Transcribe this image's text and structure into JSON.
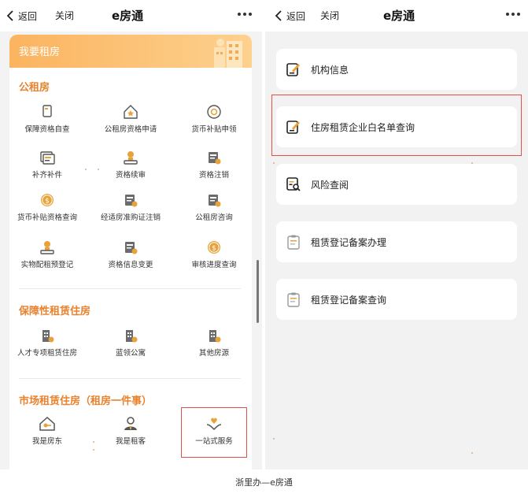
{
  "caption": "浙里办—e房通",
  "colors": {
    "accent": "#e8822d",
    "banner_start": "#fbb460",
    "banner_end": "#fdd18e",
    "highlight": "#e0514c"
  },
  "left": {
    "nav": {
      "back": "返回",
      "close": "关闭",
      "title": "e房通"
    },
    "banner_title": "我要租房",
    "sections": [
      {
        "title": "公租房",
        "items": [
          {
            "label": "保障资格自查",
            "icon": "checklist-icon"
          },
          {
            "label": "公租房资格申请",
            "icon": "house-star-icon"
          },
          {
            "label": "货币补贴申领",
            "icon": "coin-circle-icon"
          },
          {
            "label": "补齐补件",
            "icon": "document-stack-icon"
          },
          {
            "label": "资格续审",
            "icon": "stamp-icon"
          },
          {
            "label": "资格注销",
            "icon": "certificate-icon"
          },
          {
            "label": "货币补贴资格查询",
            "icon": "dollar-coin-icon"
          },
          {
            "label": "经适房准购证注销",
            "icon": "certificate-icon"
          },
          {
            "label": "公租房咨询",
            "icon": "certificate-icon"
          },
          {
            "label": "实物配租预登记",
            "icon": "stamp-icon"
          },
          {
            "label": "资格信息变更",
            "icon": "certificate-icon"
          },
          {
            "label": "审核进度查询",
            "icon": "dollar-coin-icon"
          }
        ]
      },
      {
        "title": "保障性租赁住房",
        "items": [
          {
            "label": "人才专项租赁住房",
            "icon": "building-icon"
          },
          {
            "label": "蓝领公寓",
            "icon": "building-icon"
          },
          {
            "label": "其他房源",
            "icon": "building-icon"
          }
        ]
      },
      {
        "title": "市场租赁住房（租房一件事）",
        "items": [
          {
            "label": "我是房东",
            "icon": "house-key-icon"
          },
          {
            "label": "我是租客",
            "icon": "person-icon"
          },
          {
            "label": "一站式服务",
            "icon": "hands-heart-icon"
          }
        ]
      }
    ]
  },
  "right": {
    "nav": {
      "back": "返回",
      "close": "关闭",
      "title": "e房通"
    },
    "items": [
      {
        "label": "机构信息",
        "icon": "edit-note-icon"
      },
      {
        "label": "住房租赁企业白名单查询",
        "icon": "edit-note-icon"
      },
      {
        "label": "风险查阅",
        "icon": "document-search-icon"
      },
      {
        "label": "租赁登记备案办理",
        "icon": "clipboard-icon"
      },
      {
        "label": "租赁登记备案查询",
        "icon": "clipboard-icon"
      }
    ]
  }
}
